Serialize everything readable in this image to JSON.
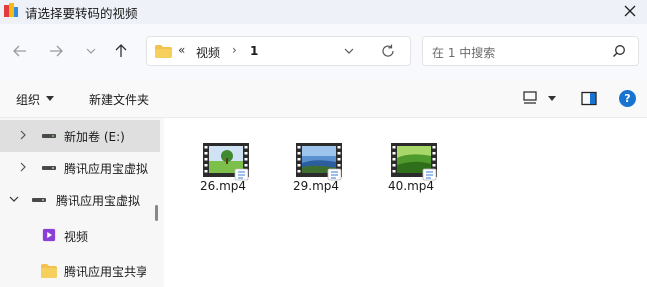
{
  "window": {
    "title": "请选择要转码的视频"
  },
  "address": {
    "overflow": "«",
    "crumbs": [
      "视频",
      "1"
    ],
    "separator": "›"
  },
  "search": {
    "placeholder": "在 1 中搜索"
  },
  "toolbar": {
    "organize_label": "组织",
    "new_folder_label": "新建文件夹"
  },
  "sidebar": {
    "items": [
      {
        "label": "新加卷 (E:)",
        "icon": "drive-icon",
        "expand": "collapsed",
        "selected": true
      },
      {
        "label": "腾讯应用宝虚拟",
        "icon": "drive-icon",
        "expand": "collapsed",
        "selected": false
      },
      {
        "label": "腾讯应用宝虚拟",
        "icon": "drive-icon",
        "expand": "expanded",
        "selected": false
      },
      {
        "label": "视频",
        "icon": "video-folder-icon",
        "expand": "none",
        "selected": false
      },
      {
        "label": "腾讯应用宝共享",
        "icon": "folder-icon",
        "expand": "none",
        "selected": false
      }
    ]
  },
  "files": [
    {
      "name": "26.mp4",
      "thumbnail": "grass-tree-scene"
    },
    {
      "name": "29.mp4",
      "thumbnail": "lake-sky-scene"
    },
    {
      "name": "40.mp4",
      "thumbnail": "green-hills-scene"
    }
  ],
  "colors": {
    "accent": "#1874d0",
    "folder": "#f2c14e",
    "selection": "#dfdfdf"
  }
}
